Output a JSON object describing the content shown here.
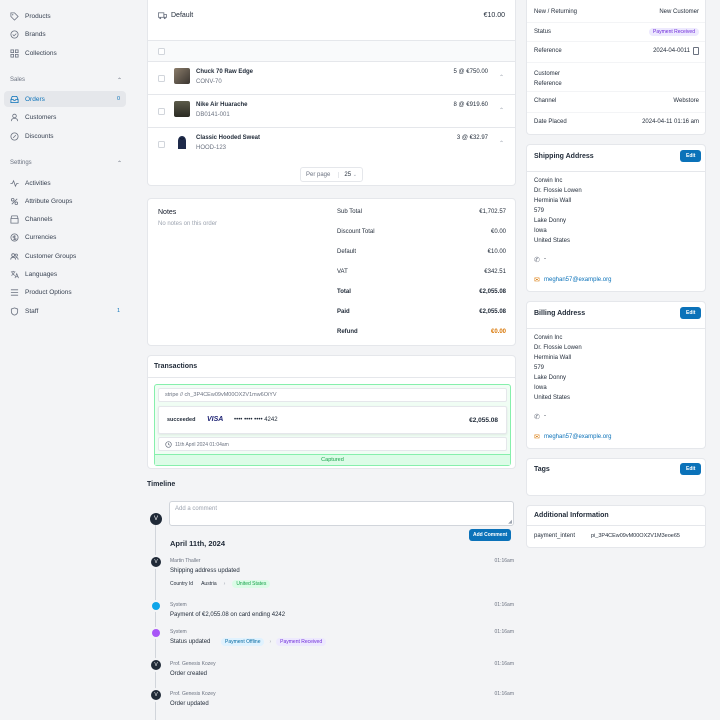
{
  "sidebar": {
    "top_items": [
      {
        "label": "Products",
        "icon": "tag-icon"
      },
      {
        "label": "Brands",
        "icon": "badge-check-icon"
      },
      {
        "label": "Collections",
        "icon": "collections-icon"
      }
    ],
    "sales_heading": "Sales",
    "sales_items": [
      {
        "label": "Orders",
        "icon": "inbox-icon",
        "count": "0",
        "active": true
      },
      {
        "label": "Customers",
        "icon": "users-icon"
      },
      {
        "label": "Discounts",
        "icon": "percent-icon"
      }
    ],
    "settings_heading": "Settings",
    "settings_items": [
      {
        "label": "Activities",
        "icon": "activity-icon"
      },
      {
        "label": "Attribute Groups",
        "icon": "attribute-icon"
      },
      {
        "label": "Channels",
        "icon": "channels-icon"
      },
      {
        "label": "Currencies",
        "icon": "currency-icon"
      },
      {
        "label": "Customer Groups",
        "icon": "user-group-icon"
      },
      {
        "label": "Languages",
        "icon": "language-icon"
      },
      {
        "label": "Product Options",
        "icon": "list-icon"
      },
      {
        "label": "Staff",
        "icon": "shield-icon",
        "count": "1"
      }
    ]
  },
  "shipping_line": {
    "label": "Default",
    "amount": "€10.00"
  },
  "lines": [
    {
      "name": "Chuck 70 Raw Edge",
      "sku": "CONV-70",
      "qty": "5 @ €750.00"
    },
    {
      "name": "Nike Air Huarache",
      "sku": "DB0141-001",
      "qty": "8 @ €919.60"
    },
    {
      "name": "Classic Hooded Sweat",
      "sku": "HOOD-123",
      "qty": "3 @ €32.97"
    }
  ],
  "pagination": {
    "label": "Per page",
    "value": "25"
  },
  "notes": {
    "title": "Notes",
    "empty": "No notes on this order"
  },
  "totals": [
    {
      "label": "Sub Total",
      "value": "€1,702.57",
      "strong": false
    },
    {
      "label": "Discount Total",
      "value": "€0.00",
      "strong": false
    },
    {
      "label": "Default",
      "value": "€10.00",
      "strong": false
    },
    {
      "label": "VAT",
      "value": "€342.51",
      "strong": false
    },
    {
      "label": "Total",
      "value": "€2,055.08",
      "strong": true
    },
    {
      "label": "Paid",
      "value": "€2,055.08",
      "strong": true
    },
    {
      "label": "Refund",
      "value": "€0.00",
      "strong": true,
      "accent": "#d97706"
    }
  ],
  "transactions": {
    "title": "Transactions",
    "reference": "stripe // ch_3P4CEw09vM00OX2V1mw6OiYV",
    "status": "succeeded",
    "card_brand": "VISA",
    "card_number": "•••• •••• •••• 4242",
    "amount": "€2,055.08",
    "date": "11th April 2024 01:04am",
    "state": "Captured"
  },
  "timeline": {
    "title": "Timeline",
    "comment_placeholder": "Add a comment",
    "add_comment": "Add Comment",
    "date_heading": "April 11th, 2024",
    "events": [
      {
        "author": "Martin Thaller",
        "text": "Shipping address updated",
        "time": "01:16am",
        "detail_label": "Country Id",
        "from": "Austria",
        "to": "United States",
        "dot": "avatar"
      },
      {
        "author": "System",
        "text": "Payment of €2,055.08 on card ending 4242",
        "time": "01:16am",
        "dot": "#0ea5e9"
      },
      {
        "author": "System",
        "text": "Status updated",
        "time": "01:16am",
        "from": "Payment Offline",
        "to": "Payment Received",
        "dot": "#a855f7"
      },
      {
        "author": "Prof. Genesis Kozey",
        "text": "Order created",
        "time": "01:16am",
        "dot": "avatar"
      },
      {
        "author": "Prof. Genesis Kozey",
        "text": "Order updated",
        "time": "01:16am",
        "dot": "avatar"
      }
    ]
  },
  "details": {
    "rows": [
      {
        "label": "New / Returning",
        "value": "New Customer"
      },
      {
        "label": "Status",
        "value": "Payment Received",
        "badge": true
      },
      {
        "label": "Reference",
        "value": "2024-04-0011"
      },
      {
        "label": "Customer Reference",
        "value": ""
      },
      {
        "label": "Channel",
        "value": "Webstore"
      },
      {
        "label": "Date Placed",
        "value": "2024-04-11 01:16 am"
      }
    ]
  },
  "shipping_address": {
    "title": "Shipping Address",
    "edit": "Edit",
    "lines": [
      "Corwin Inc",
      "Dr. Flossie Lowen",
      "Herminia Wall",
      "579",
      "Lake Donny",
      "Iowa",
      "United States"
    ],
    "phone": "-",
    "email": "meghan57@example.org"
  },
  "billing_address": {
    "title": "Billing Address",
    "edit": "Edit",
    "lines": [
      "Corwin Inc",
      "Dr. Flossie Lowen",
      "Herminia Wall",
      "579",
      "Lake Donny",
      "Iowa",
      "United States"
    ],
    "phone": "-",
    "email": "meghan57@example.org"
  },
  "tags": {
    "title": "Tags",
    "edit": "Edit"
  },
  "additional": {
    "title": "Additional Information",
    "key": "payment_intent",
    "value": "pi_3P4CEw09vM00OX2V1M3eoe65"
  },
  "colors": {
    "accent": "#0b72b9",
    "success": "#16a34a",
    "warning": "#d97706"
  }
}
